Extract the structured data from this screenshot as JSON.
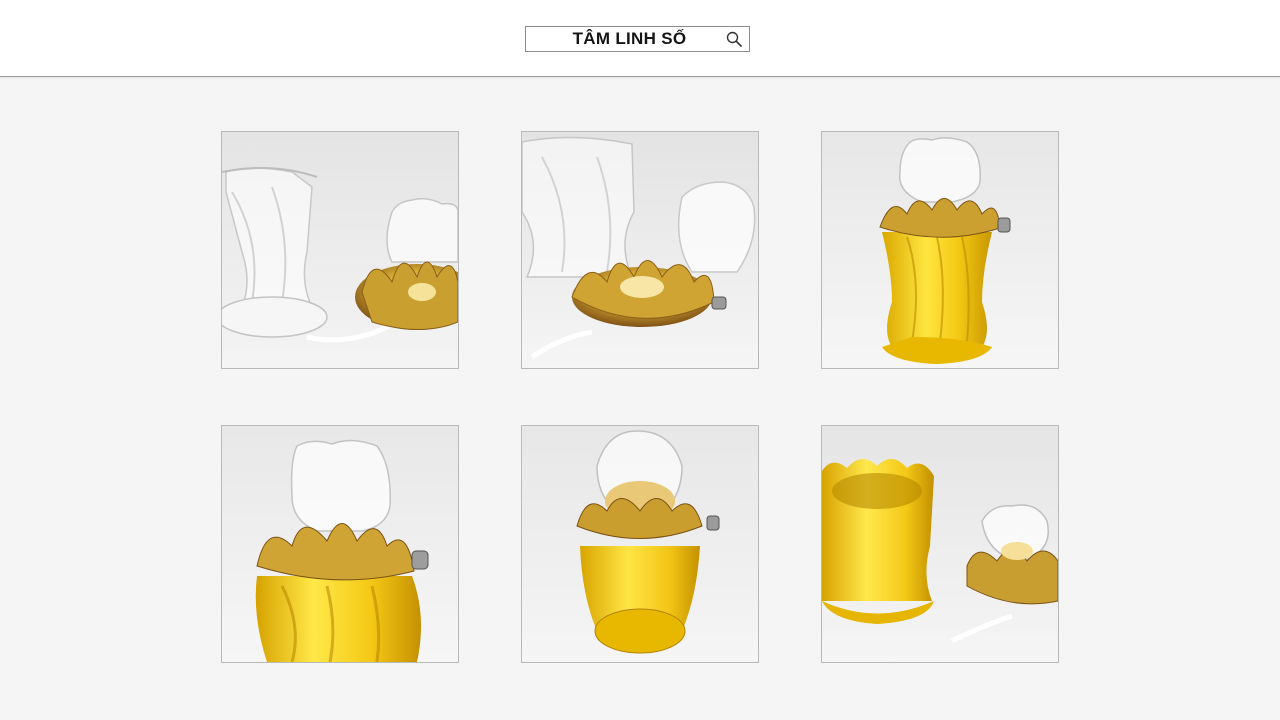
{
  "header": {
    "search": {
      "value": "TÂM LINH SỐ",
      "icon": "search-icon"
    }
  },
  "gallery": {
    "items": [
      {
        "subject": "clear-glass-lamp-and-gold-lotus"
      },
      {
        "subject": "gold-lotus-holder-with-clear-cups"
      },
      {
        "subject": "yellow-lotus-oil-lamp"
      },
      {
        "subject": "yellow-lotus-oil-lamp-closeup"
      },
      {
        "subject": "yellow-lotus-oil-lamp-top-view"
      },
      {
        "subject": "yellow-cup-and-small-lamp"
      }
    ]
  },
  "colors": {
    "glass_yellow": "#f0c810",
    "gold": "#c8a030",
    "background": "#f5f5f5"
  }
}
